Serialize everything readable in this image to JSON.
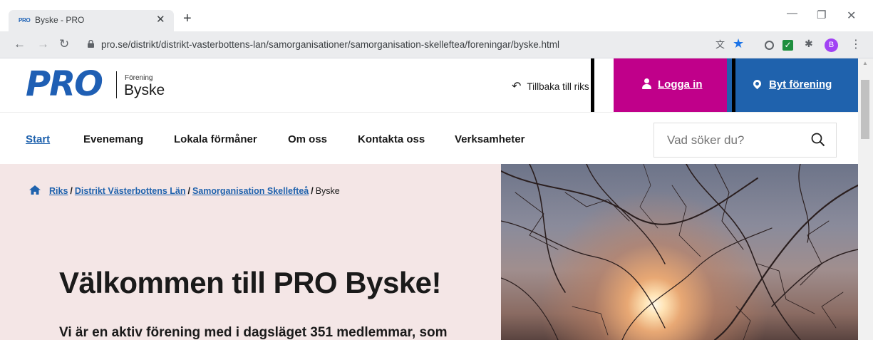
{
  "browser": {
    "tab_title": "Byske - PRO",
    "tab_favicon_text": "PRO",
    "url": "pro.se/distrikt/distrikt-vasterbottens-lan/samorganisationer/samorganisation-skelleftea/foreningar/byske.html",
    "profile_initial": "B",
    "icons": [
      "back-arrow-icon",
      "forward-arrow-icon",
      "reload-icon",
      "lock-icon",
      "translate-icon",
      "star-icon",
      "extensions-icon",
      "menu-icon"
    ]
  },
  "header": {
    "logo_text": "PRO",
    "association_kicker": "Förening",
    "association_name": "Byske",
    "back_link": "Tillbaka till riks",
    "login_label": "Logga in",
    "switch_label": "Byt förening",
    "colors": {
      "brand_blue": "#1f62ad",
      "login_magenta": "#c0008a"
    }
  },
  "nav": {
    "items": [
      {
        "label": "Start",
        "active": true
      },
      {
        "label": "Evenemang",
        "active": false
      },
      {
        "label": "Lokala förmåner",
        "active": false
      },
      {
        "label": "Om oss",
        "active": false
      },
      {
        "label": "Kontakta oss",
        "active": false
      },
      {
        "label": "Verksamheter",
        "active": false
      }
    ],
    "search_placeholder": "Vad söker du?"
  },
  "breadcrumb": {
    "items": [
      "Riks",
      "Distrikt Västerbottens Län",
      "Samorganisation Skellefteå"
    ],
    "separator": "/",
    "current": "Byske"
  },
  "hero": {
    "title": "Välkommen till PRO Byske!",
    "text": "Vi är en aktiv förening med i dagsläget 351 medlemmar, som"
  }
}
